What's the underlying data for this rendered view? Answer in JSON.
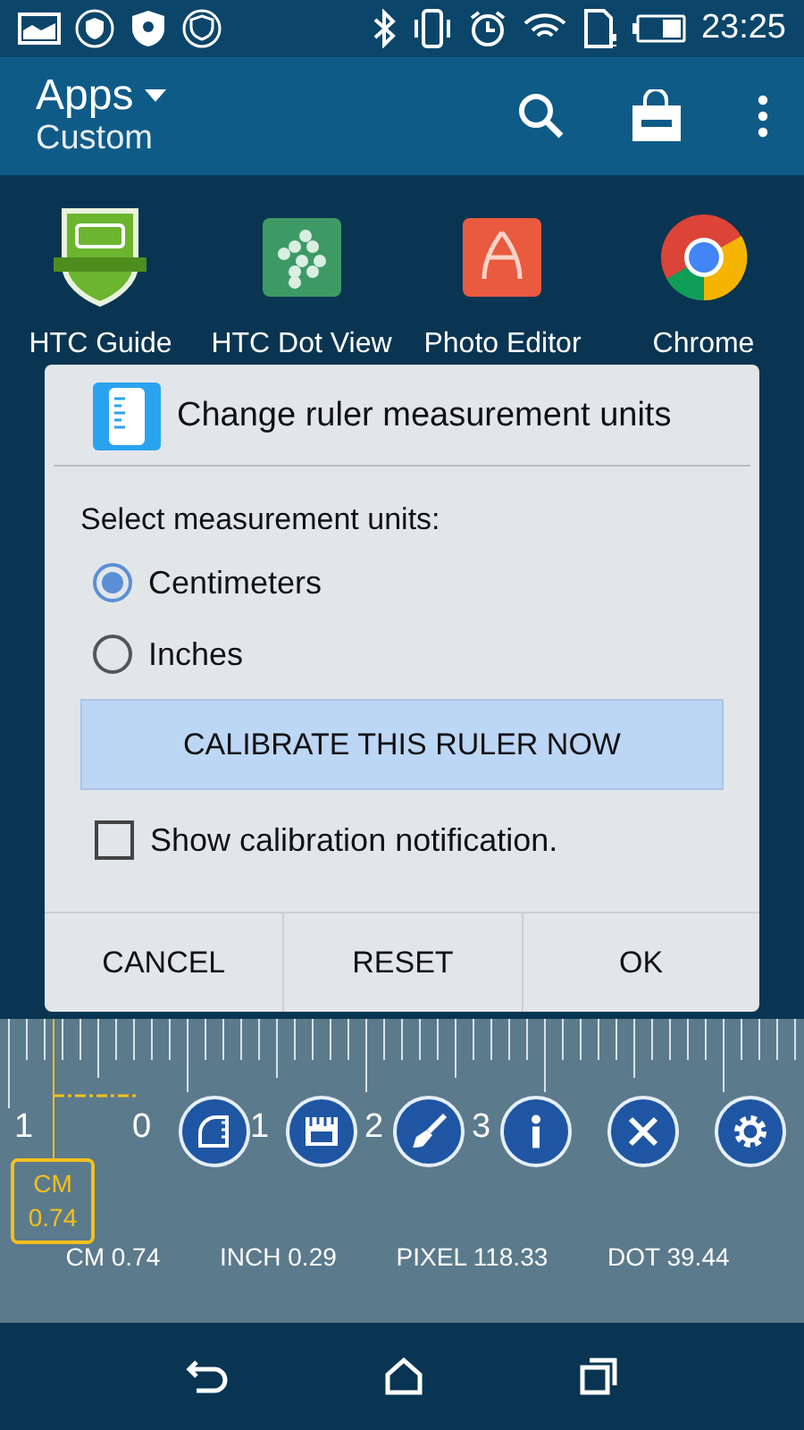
{
  "status_bar": {
    "time": "23:25"
  },
  "app_bar": {
    "title": "Apps",
    "subtitle": "Custom"
  },
  "apps": [
    {
      "label": "HTC Guide"
    },
    {
      "label": "HTC Dot View"
    },
    {
      "label": "Photo Editor"
    },
    {
      "label": "Chrome"
    }
  ],
  "dialog": {
    "title": "Change ruler measurement units",
    "prompt": "Select measurement units:",
    "options": [
      {
        "label": "Centimeters",
        "selected": true
      },
      {
        "label": "Inches",
        "selected": false
      }
    ],
    "calibrate_button": "CALIBRATE THIS RULER NOW",
    "notification_checkbox": {
      "label": "Show calibration notification.",
      "checked": false
    },
    "buttons": [
      "CANCEL",
      "RESET",
      "OK"
    ]
  },
  "ruler": {
    "scale_labels": [
      "1",
      "0",
      "1",
      "2",
      "3"
    ],
    "marker": {
      "unit": "CM",
      "value": "0.74"
    },
    "tools": [
      {
        "kind": "protractor"
      },
      {
        "kind": "units"
      },
      {
        "kind": "brush"
      },
      {
        "kind": "info"
      },
      {
        "kind": "close"
      },
      {
        "kind": "settings"
      }
    ],
    "readings": [
      "CM 0.74",
      "INCH 0.29",
      "PIXEL 118.33",
      "DOT 39.44"
    ]
  }
}
